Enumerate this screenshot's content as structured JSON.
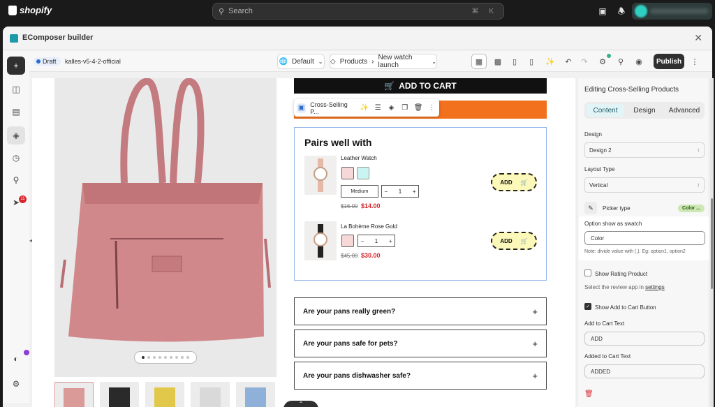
{
  "shopify": {
    "logo_text": "shopify",
    "search_placeholder": "Search",
    "search_shortcut": "⌘ K"
  },
  "builder": {
    "title": "EComposer builder",
    "status_badge": "Draft",
    "theme_name": "kalles-v5-4-2-official",
    "language_select": "Default",
    "breadcrumb": {
      "section": "Products",
      "page": "New watch launch"
    },
    "publish_label": "Publish",
    "notification_count": "11"
  },
  "canvas": {
    "add_to_cart_label": "ADD TO CART",
    "element_toolbar_label": "Cross-Selling P...",
    "cross_sell": {
      "title": "Pairs well with",
      "products": [
        {
          "name": "Leather Watch",
          "variant": "Medium",
          "quantity": "1",
          "old_price": "$16.00",
          "new_price": "$14.00",
          "swatch_colors": [
            "#f7d8d8",
            "#c9f4f1"
          ]
        },
        {
          "name": "La Bohème Rose Gold",
          "quantity": "1",
          "old_price": "$45.00",
          "new_price": "$30.00",
          "swatch_colors": [
            "#f7d8d8"
          ]
        }
      ],
      "add_label": "ADD"
    },
    "faqs": [
      "Are your pans really green?",
      "Are your pans safe for pets?",
      "Are your pans dishwasher safe?"
    ],
    "thumb_colors": [
      "#d99a98",
      "#2a2a2a",
      "#e2c84a",
      "#d9d9d9",
      "#8fb0d8"
    ]
  },
  "panel": {
    "heading": "Editing Cross-Selling Products",
    "tabs": [
      "Content",
      "Design",
      "Advanced"
    ],
    "active_tab": "Content",
    "design_label": "Design",
    "design_value": "Design 2",
    "layout_label": "Layout Type",
    "layout_value": "Vertical",
    "picker_label": "Picker type",
    "picker_value": "Color ...",
    "swatch_label": "Option show as swatch",
    "swatch_value": "Color",
    "swatch_note": "Note: divide value with (,). Eg: option1, option2",
    "rating_label": "Show Rating Product",
    "rating_note": "Select the review app in",
    "rating_link": "settings",
    "show_atc_label": "Show Add to Cart Button",
    "atc_text_label": "Add to Cart Text",
    "atc_text_value": "ADD",
    "added_text_label": "Added to Cart Text",
    "added_text_value": "ADDED"
  },
  "colors": {
    "accent_orange": "#f2711c",
    "price_red": "#d7262b",
    "selection_blue": "#8fb3e8",
    "add_button_fill": "#fbf8b9"
  }
}
